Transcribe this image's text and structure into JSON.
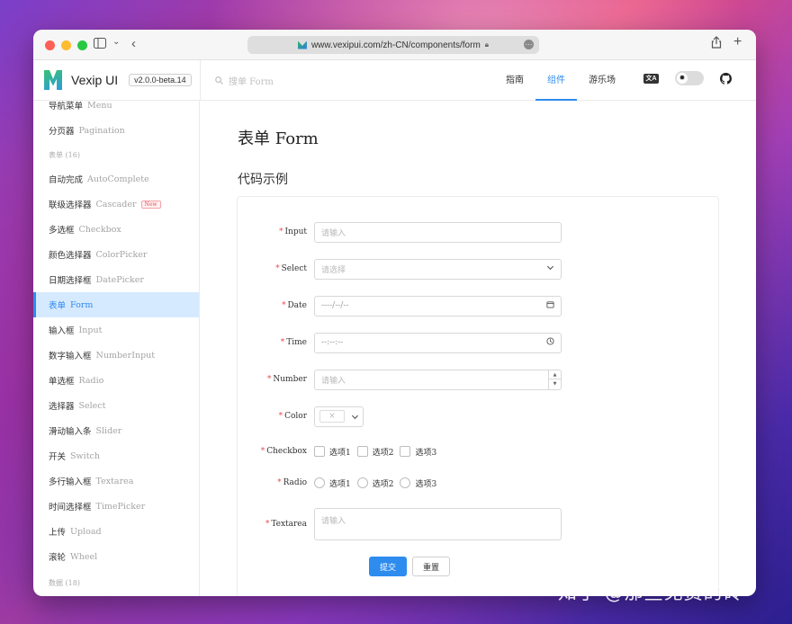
{
  "browser": {
    "url": "www.vexipui.com/zh-CN/components/form"
  },
  "header": {
    "brand_name": "Vexip UI",
    "version": "v2.0.0-beta.14",
    "search_placeholder": "搜单 Form",
    "nav": [
      {
        "label": "指南",
        "active": false
      },
      {
        "label": "组件",
        "active": true
      },
      {
        "label": "游乐场",
        "active": false
      }
    ],
    "lang_icon": "文A"
  },
  "sidebar": {
    "items": [
      {
        "type": "item",
        "zh": "导航菜单",
        "en": "Menu"
      },
      {
        "type": "item",
        "zh": "分页器",
        "en": "Pagination"
      },
      {
        "type": "group",
        "label": "表单 (16)"
      },
      {
        "type": "item",
        "zh": "自动完成",
        "en": "AutoComplete"
      },
      {
        "type": "item",
        "zh": "联级选择器",
        "en": "Cascader",
        "tag": "New"
      },
      {
        "type": "item",
        "zh": "多选框",
        "en": "Checkbox"
      },
      {
        "type": "item",
        "zh": "颜色选择器",
        "en": "ColorPicker"
      },
      {
        "type": "item",
        "zh": "日期选择框",
        "en": "DatePicker"
      },
      {
        "type": "item",
        "zh": "表单",
        "en": "Form",
        "active": true
      },
      {
        "type": "item",
        "zh": "输入框",
        "en": "Input"
      },
      {
        "type": "item",
        "zh": "数字输入框",
        "en": "NumberInput"
      },
      {
        "type": "item",
        "zh": "单选框",
        "en": "Radio"
      },
      {
        "type": "item",
        "zh": "选择器",
        "en": "Select"
      },
      {
        "type": "item",
        "zh": "滑动输入条",
        "en": "Slider"
      },
      {
        "type": "item",
        "zh": "开关",
        "en": "Switch"
      },
      {
        "type": "item",
        "zh": "多行输入框",
        "en": "Textarea"
      },
      {
        "type": "item",
        "zh": "时间选择框",
        "en": "TimePicker"
      },
      {
        "type": "item",
        "zh": "上传",
        "en": "Upload"
      },
      {
        "type": "item",
        "zh": "滚轮",
        "en": "Wheel"
      },
      {
        "type": "group",
        "label": "数据 (18)"
      }
    ]
  },
  "main": {
    "page_title": "表单 Form",
    "section_title": "代码示例",
    "form": {
      "input": {
        "label": "Input",
        "placeholder": "请输入"
      },
      "select": {
        "label": "Select",
        "placeholder": "请选择"
      },
      "date": {
        "label": "Date",
        "placeholder": "----/--/--"
      },
      "time": {
        "label": "Time",
        "placeholder": "--:--:--"
      },
      "number": {
        "label": "Number",
        "placeholder": "请输入"
      },
      "color": {
        "label": "Color",
        "swatch": "×"
      },
      "checkbox": {
        "label": "Checkbox",
        "options": [
          "选项1",
          "选项2",
          "选项3"
        ]
      },
      "radio": {
        "label": "Radio",
        "options": [
          "选项1",
          "选项2",
          "选项3"
        ]
      },
      "textarea": {
        "label": "Textarea",
        "placeholder": "请输入"
      },
      "submit_label": "提交",
      "reset_label": "重置"
    }
  },
  "watermark": "知乎 @那些免费的砖",
  "colors": {
    "accent": "#2e8cef",
    "required": "#ef4a4a",
    "active_bg": "#d6eaff"
  }
}
